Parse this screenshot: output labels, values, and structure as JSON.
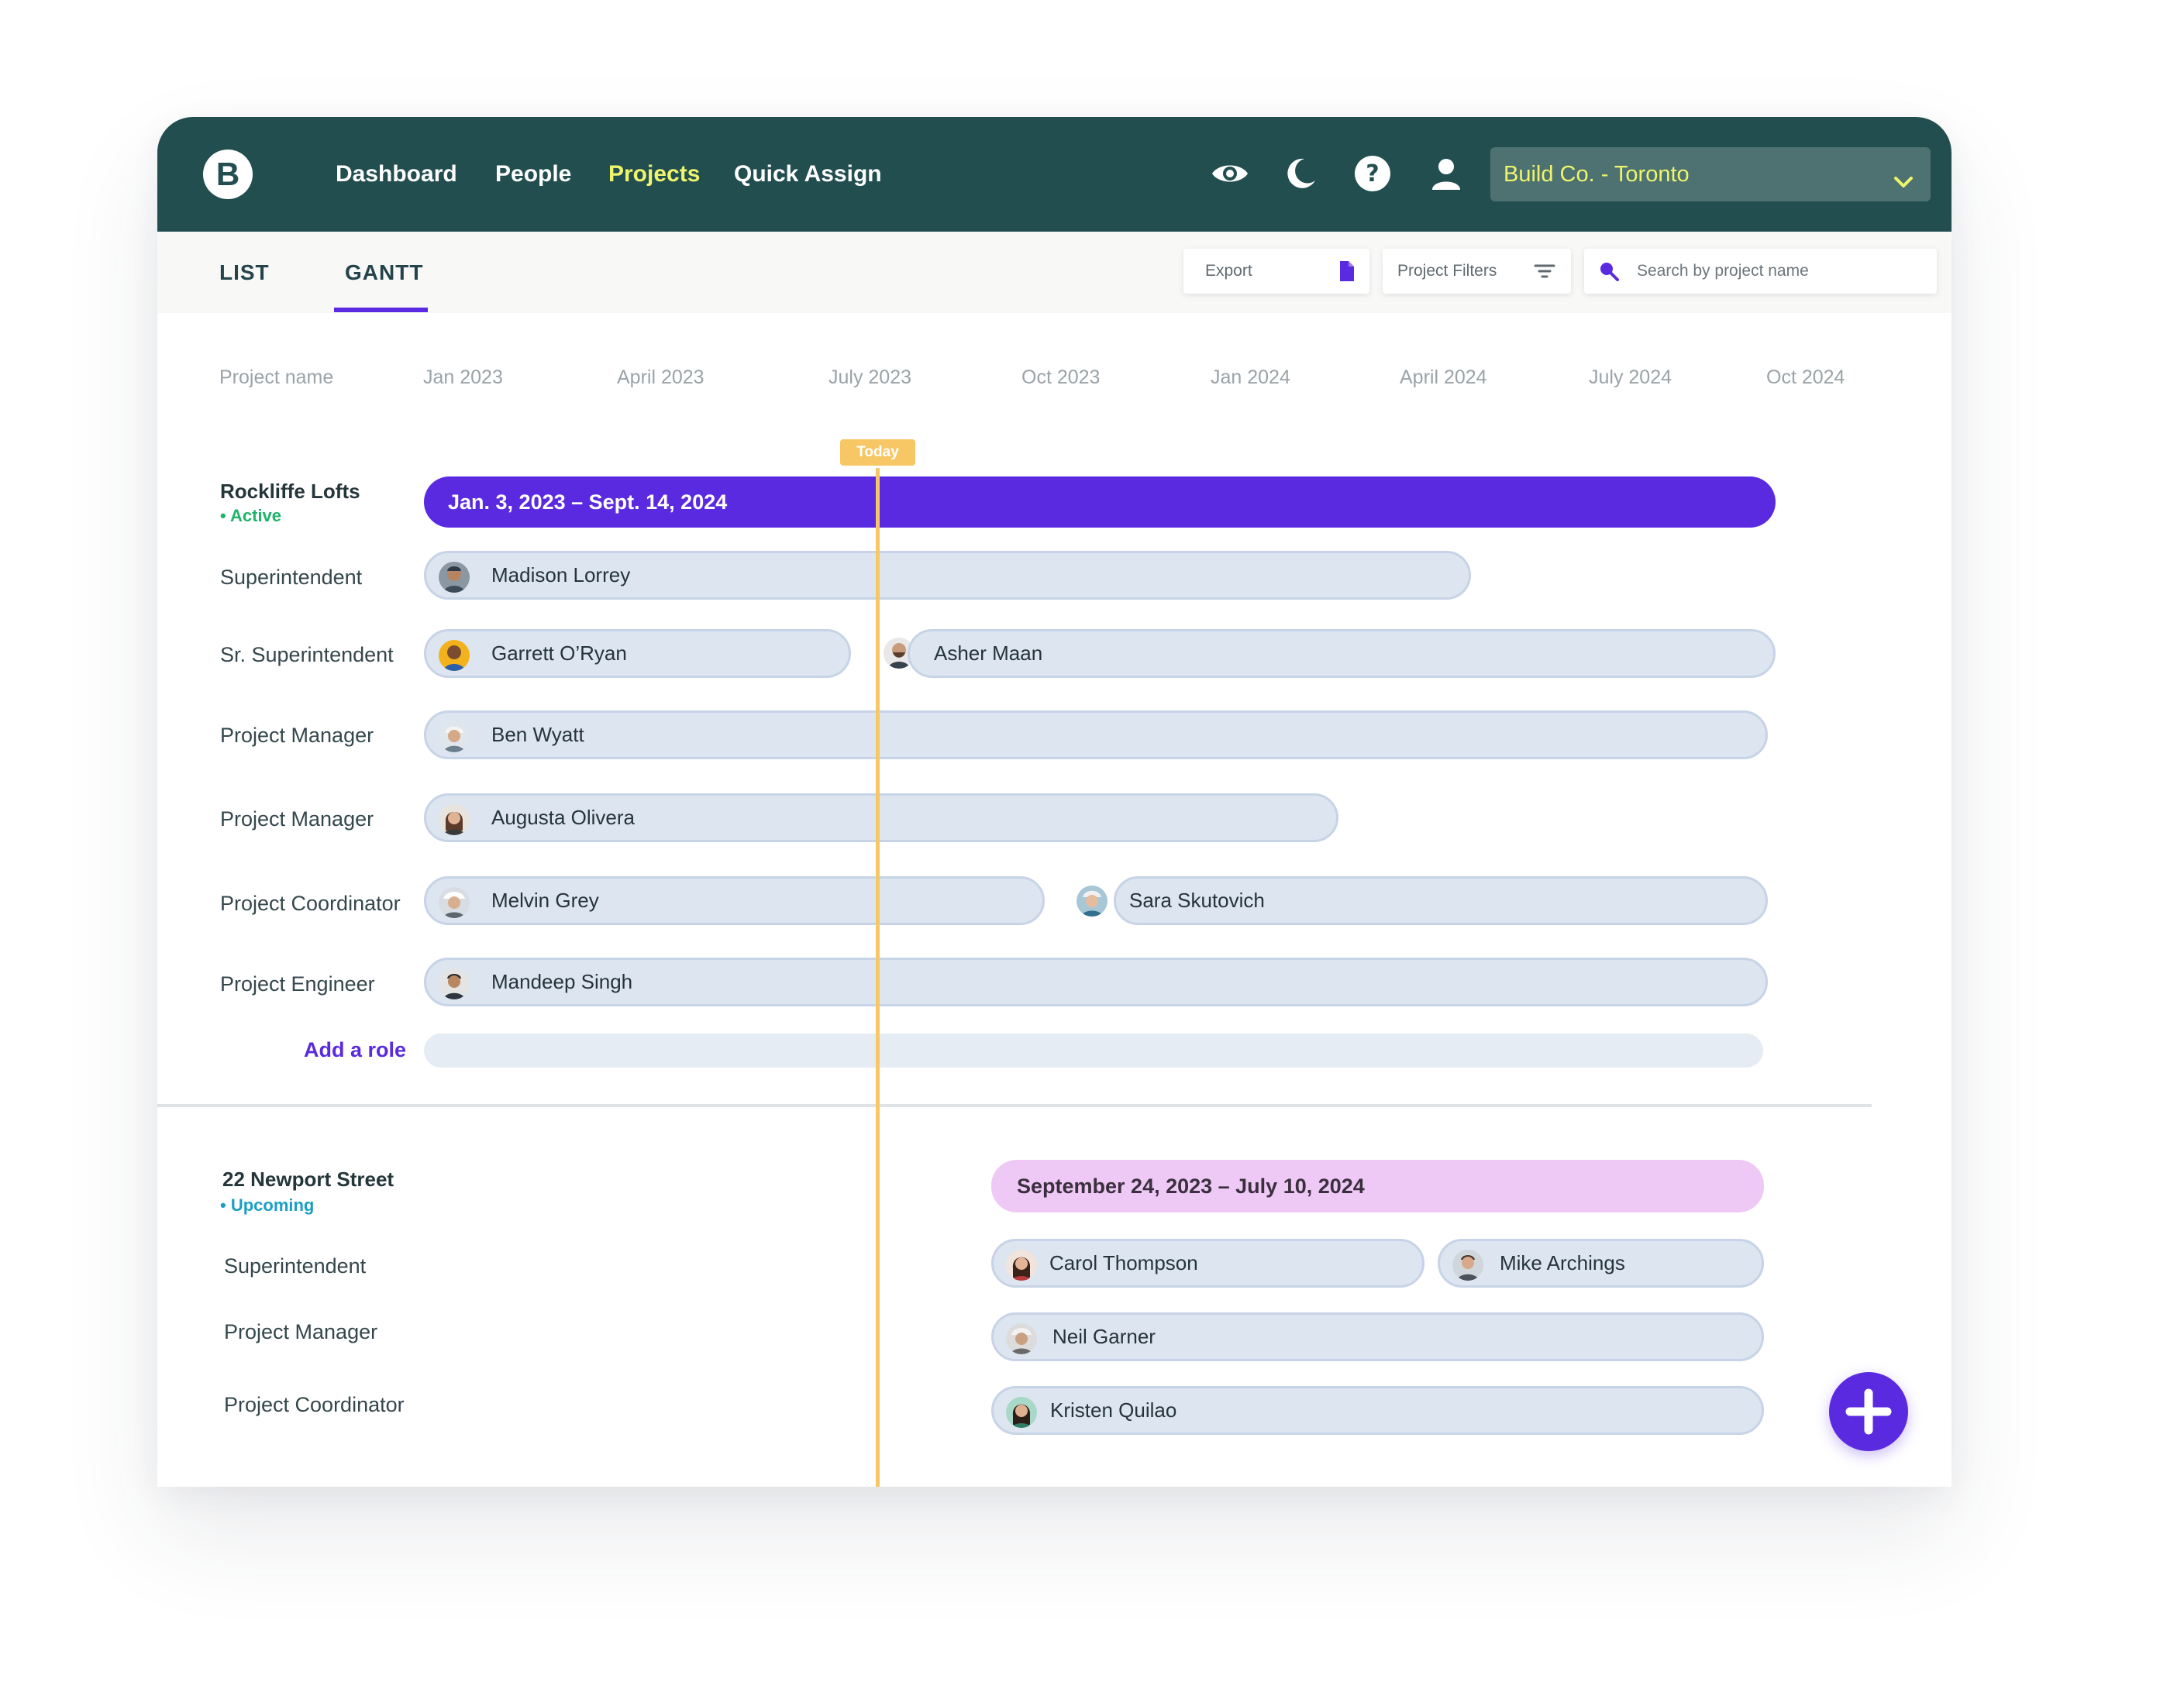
{
  "header": {
    "logo_letter": "B",
    "nav": [
      "Dashboard",
      "People",
      "Projects",
      "Quick Assign"
    ],
    "active_nav": "Projects",
    "icons": [
      "eye-icon",
      "moon-icon",
      "help-icon",
      "user-icon"
    ],
    "company_select": "Build Co. - Toronto"
  },
  "tabs": {
    "list": "LIST",
    "gantt": "GANTT",
    "active": "GANTT"
  },
  "toolbar": {
    "export_label": "Export",
    "filters_label": "Project Filters",
    "search_placeholder": "Search by project name"
  },
  "gantt": {
    "column_header": "Project name",
    "months": [
      "Jan 2023",
      "April 2023",
      "July 2023",
      "Oct 2023",
      "Jan 2024",
      "April 2024",
      "July 2024",
      "Oct 2024"
    ],
    "today_label": "Today",
    "projects": [
      {
        "name": "Rockliffe Lofts",
        "status": "• Active",
        "date_range": "Jan. 3, 2023 – Sept. 14, 2024",
        "roles": [
          {
            "role": "Superintendent",
            "people": [
              "Madison Lorrey"
            ]
          },
          {
            "role": "Sr. Superintendent",
            "people": [
              "Garrett O’Ryan",
              "Asher Maan"
            ]
          },
          {
            "role": "Project Manager",
            "people": [
              "Ben Wyatt"
            ]
          },
          {
            "role": "Project Manager",
            "people": [
              "Augusta Olivera"
            ]
          },
          {
            "role": "Project Coordinator",
            "people": [
              "Melvin Grey",
              "Sara Skutovich"
            ]
          },
          {
            "role": "Project Engineer",
            "people": [
              "Mandeep Singh"
            ]
          }
        ],
        "add_role": "Add a role"
      },
      {
        "name": "22 Newport Street",
        "status": "• Upcoming",
        "date_range": "September 24, 2023 – July 10, 2024",
        "roles": [
          {
            "role": "Superintendent",
            "people": [
              "Carol Thompson",
              "Mike Archings"
            ]
          },
          {
            "role": "Project Manager",
            "people": [
              "Neil Garner"
            ]
          },
          {
            "role": "Project Coordinator",
            "people": [
              "Kristen Quilao"
            ]
          }
        ]
      }
    ]
  },
  "colors": {
    "header_bg": "#224e50",
    "accent": "#5a2ae0",
    "active_nav": "#eef56b",
    "active_status": "#1fb46a",
    "upcoming_status": "#1a9fc4",
    "upcoming_bar": "#efc9f5",
    "today": "#f7c766"
  }
}
